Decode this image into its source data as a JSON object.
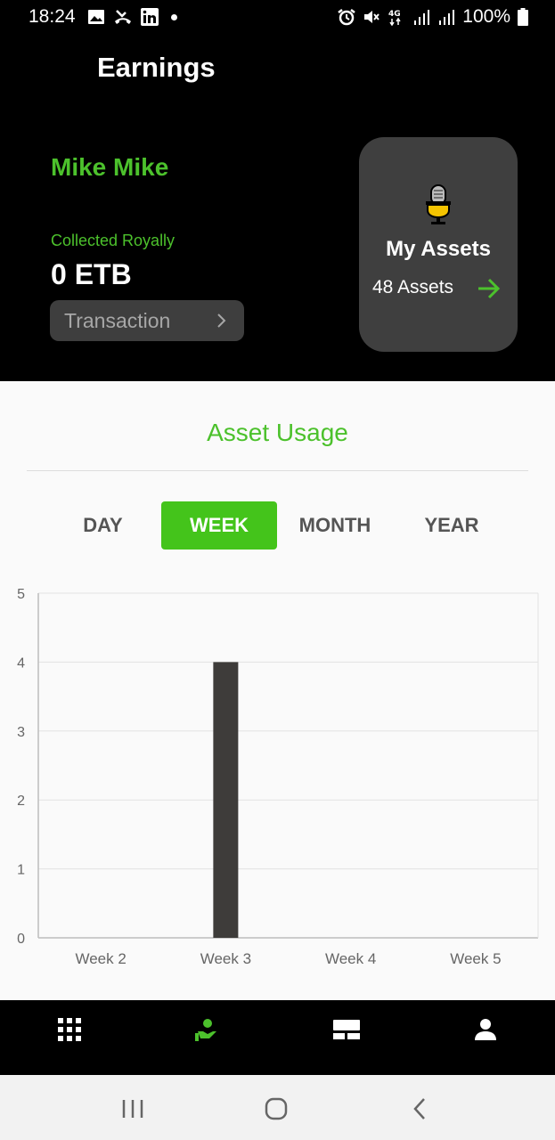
{
  "status_bar": {
    "time": "18:24",
    "battery": "100%",
    "network": "4G"
  },
  "header": {
    "title": "Earnings",
    "user_name": "Mike Mike",
    "royalty_label": "Collected Royally",
    "royalty_value": "0 ETB",
    "transaction_label": "Transaction"
  },
  "assets_card": {
    "title": "My Assets",
    "count_label": "48 Assets",
    "icon": "microphone-icon"
  },
  "usage": {
    "title": "Asset Usage",
    "tabs": [
      {
        "label": "DAY",
        "active": false
      },
      {
        "label": "WEEK",
        "active": true
      },
      {
        "label": "MONTH",
        "active": false
      },
      {
        "label": "YEAR",
        "active": false
      }
    ]
  },
  "chart_data": {
    "type": "bar",
    "categories": [
      "Week 2",
      "Week 3",
      "Week 4",
      "Week 5"
    ],
    "values": [
      0,
      4,
      0,
      0
    ],
    "ylim": [
      0,
      5
    ],
    "yticks": [
      "0",
      "1",
      "2",
      "3",
      "4",
      "5"
    ],
    "grid": true,
    "bar_color": "#3e3c3a"
  },
  "bottom_nav": {
    "items": [
      "grid-icon",
      "royalty-hand-icon",
      "devices-icon",
      "profile-icon"
    ],
    "active_index": 1,
    "accent": "#4cc12c"
  },
  "colors": {
    "accent": "#4cc12c",
    "card": "#3f3f3f"
  }
}
